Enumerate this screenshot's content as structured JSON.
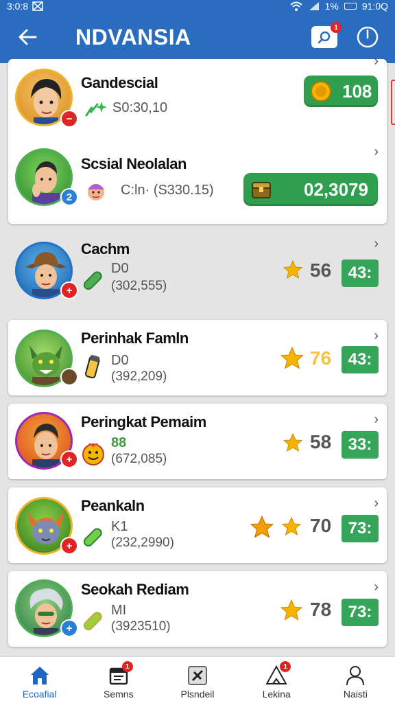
{
  "status_bar": {
    "time_left": "3:0:8",
    "battery": "1%",
    "time_right": "91:0Q"
  },
  "app_bar": {
    "title": "NDVANSIA",
    "search_badge": "1"
  },
  "top_card": {
    "rows": [
      {
        "name": "Gandescial",
        "sub": "S0:30,10",
        "coins": "108",
        "avatar_badge": "−"
      },
      {
        "name": "Scsial Neolalan",
        "sub": "C:ln· (S330.15)",
        "coins": "02,3079",
        "avatar_badge": "2"
      }
    ]
  },
  "players": [
    {
      "name": "Cachm",
      "line1": "D0",
      "line2": "(302,555)",
      "score": "56",
      "rank": "43:",
      "avatar_badge": "+"
    },
    {
      "name": "Perinhak Famln",
      "line1": "D0",
      "line2": "(392,209)",
      "score": "76",
      "rank": "43:",
      "avatar_badge": ""
    },
    {
      "name": "Peringkat Pemaim",
      "line1": "88",
      "line2": "(672,085)",
      "score": "58",
      "rank": "33:",
      "avatar_badge": "+"
    },
    {
      "name": "Peankaln",
      "line1": "K1",
      "line2": "(232,2990)",
      "score": "70",
      "rank": "73:",
      "avatar_badge": "+"
    },
    {
      "name": "Seokah Rediam",
      "line1": "MI",
      "line2": "(3923510)",
      "score": "78",
      "rank": "73:",
      "avatar_badge": "+"
    }
  ],
  "bottom_nav": [
    {
      "label": "Ecoafial",
      "icon": "home-icon",
      "active": true
    },
    {
      "label": "Semns",
      "icon": "calendar-icon",
      "badge": "1"
    },
    {
      "label": "Plsndeil",
      "icon": "tools-icon"
    },
    {
      "label": "Lekina",
      "icon": "warning-icon",
      "badge": "1"
    },
    {
      "label": "Naisti",
      "icon": "profile-icon"
    }
  ],
  "colors": {
    "primary": "#2a6dc0",
    "green": "#35a55a",
    "star": "#f4b400",
    "highlight_score": "#f5c242",
    "badge_red": "#e02424"
  }
}
